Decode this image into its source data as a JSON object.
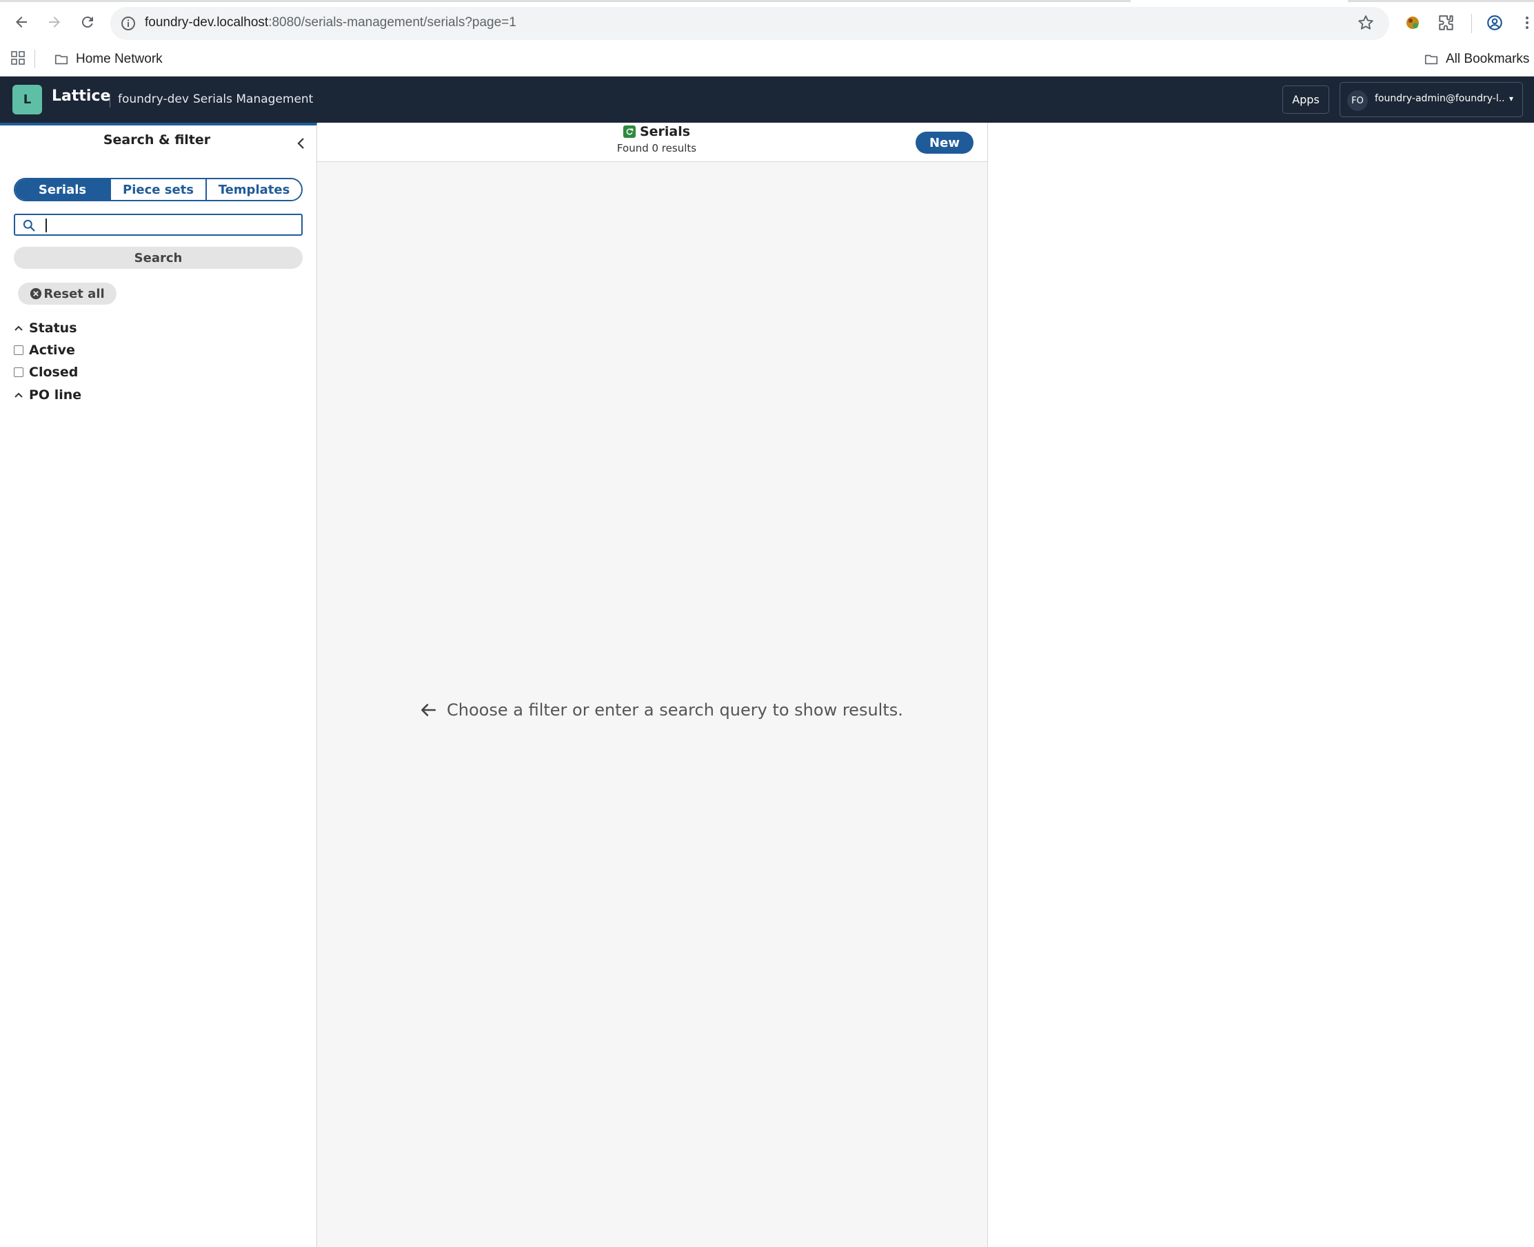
{
  "browser": {
    "url_host": "foundry-dev.localhost",
    "url_rest": ":8080/serials-management/serials?page=1",
    "bookmarks": [
      "Home Network"
    ],
    "all_bookmarks_label": "All Bookmarks"
  },
  "header": {
    "logo_letter": "L",
    "brand": "Lattice",
    "tenant": "foundry-dev",
    "module": "Serials Management",
    "apps_label": "Apps",
    "user_initials": "FO",
    "user_name": "foundry-admin@foundry-l...",
    "user_caret": "▾"
  },
  "sidebar": {
    "title": "Search & filter",
    "segments": [
      {
        "label": "Serials",
        "active": true
      },
      {
        "label": "Piece sets",
        "active": false
      },
      {
        "label": "Templates",
        "active": false
      }
    ],
    "search_value": "",
    "search_button": "Search",
    "reset_label": "Reset all",
    "facets": {
      "status": {
        "label": "Status",
        "options": [
          {
            "label": "Active",
            "checked": false
          },
          {
            "label": "Closed",
            "checked": false
          }
        ]
      },
      "po_line": {
        "label": "PO line"
      }
    }
  },
  "results": {
    "title": "Serials",
    "count_text": "Found 0 results",
    "new_label": "New",
    "empty_message": "Choose a filter or enter a search query to show results."
  },
  "colors": {
    "primary": "#1f5b99",
    "header_bg": "#1b2636",
    "logo": "#5fbfa6",
    "serial_icon": "#2f8a3e"
  }
}
